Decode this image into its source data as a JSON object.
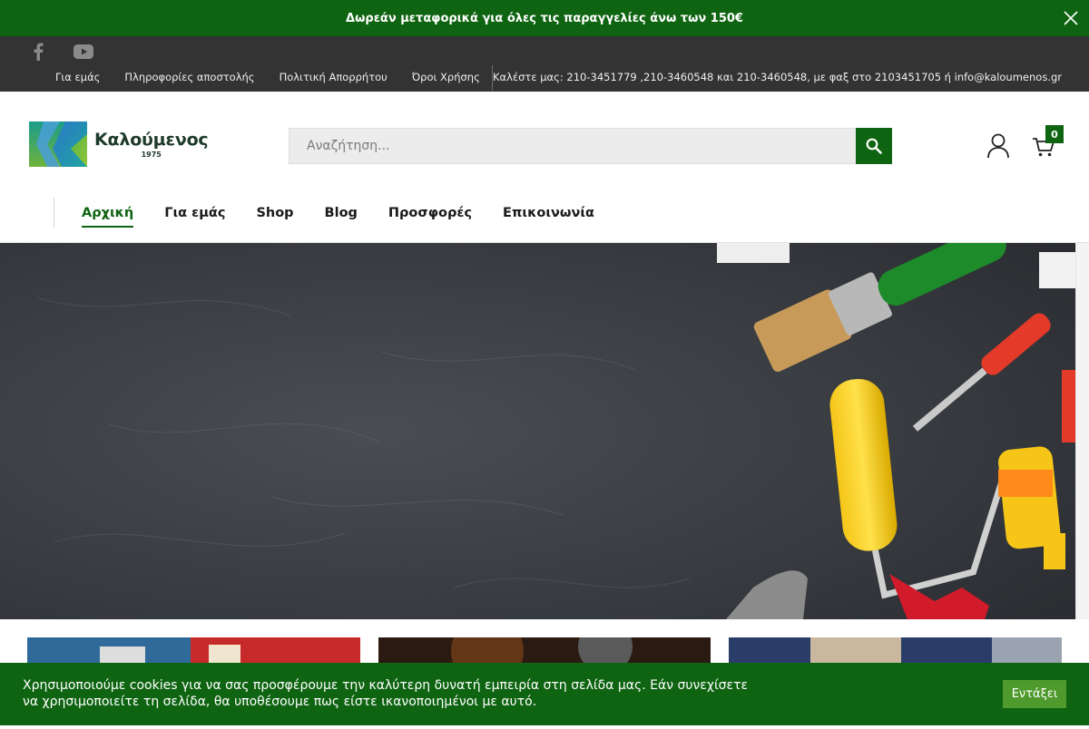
{
  "promo": {
    "text": "Δωρεάν μεταφορικά για όλες τις παραγγελίες άνω των 150€",
    "close_icon": "close-icon"
  },
  "topbar": {
    "social": [
      {
        "icon": "facebook-icon"
      },
      {
        "icon": "youtube-icon"
      }
    ],
    "links": [
      {
        "label": "Για εμάς"
      },
      {
        "label": "Πληροφορίες αποστολής"
      },
      {
        "label": "Πολιτική Απορρήτου"
      },
      {
        "label": "Όροι Χρήσης"
      }
    ],
    "contact": "Καλέστε μας: 210-3451779 ,210-3460548 και 210-3460548, με φαξ στο 2103451705 ή info@kaloumenos.gr"
  },
  "header": {
    "logo_name": "Καλούμενος",
    "logo_year": "1975",
    "search_placeholder": "Αναζήτηση...",
    "search_icon": "search-icon",
    "user_icon": "user-icon",
    "cart_icon": "cart-icon",
    "cart_count": "0"
  },
  "nav": {
    "items": [
      {
        "label": "Αρχική",
        "active": true
      },
      {
        "label": "Για εμάς"
      },
      {
        "label": "Shop"
      },
      {
        "label": "Blog"
      },
      {
        "label": "Προσφορές"
      },
      {
        "label": "Επικοινωνία"
      }
    ]
  },
  "cookie": {
    "text": "Χρησιμοποιούμε cookies για να σας προσφέρουμε την καλύτερη δυνατή εμπειρία στη σελίδα μας. Εάν συνεχίσετε να χρησιμοποιείτε τη σελίδα, θα υποθέσουμε πως είστε ικανοποιημένοι με αυτό.",
    "accept_label": "Εντάξει"
  },
  "colors": {
    "brand_green": "#0f6412",
    "topbar_bg": "#333333",
    "cookie_button": "#4f9a2c"
  }
}
